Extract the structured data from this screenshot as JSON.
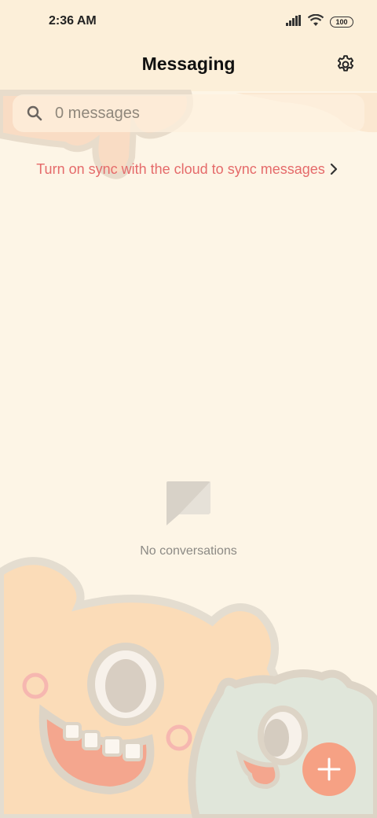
{
  "status_bar": {
    "time": "2:36 AM",
    "battery": "100",
    "icons": [
      "signal-icon",
      "wifi-icon",
      "battery-icon"
    ]
  },
  "header": {
    "title": "Messaging",
    "settings_icon": "gear-icon"
  },
  "search": {
    "placeholder": "0 messages",
    "icon": "search-icon"
  },
  "sync_banner": {
    "text": "Turn on sync with the cloud to sync messages",
    "icon": "chevron-right-icon",
    "color": "#e56a6a"
  },
  "empty_state": {
    "icon": "message-bubble-icon",
    "text": "No conversations"
  },
  "fab": {
    "icon": "plus-icon",
    "color": "#f6a184"
  },
  "colors": {
    "background": "#fdf5e6",
    "accent": "#f6a184",
    "sync_text": "#e56a6a"
  }
}
